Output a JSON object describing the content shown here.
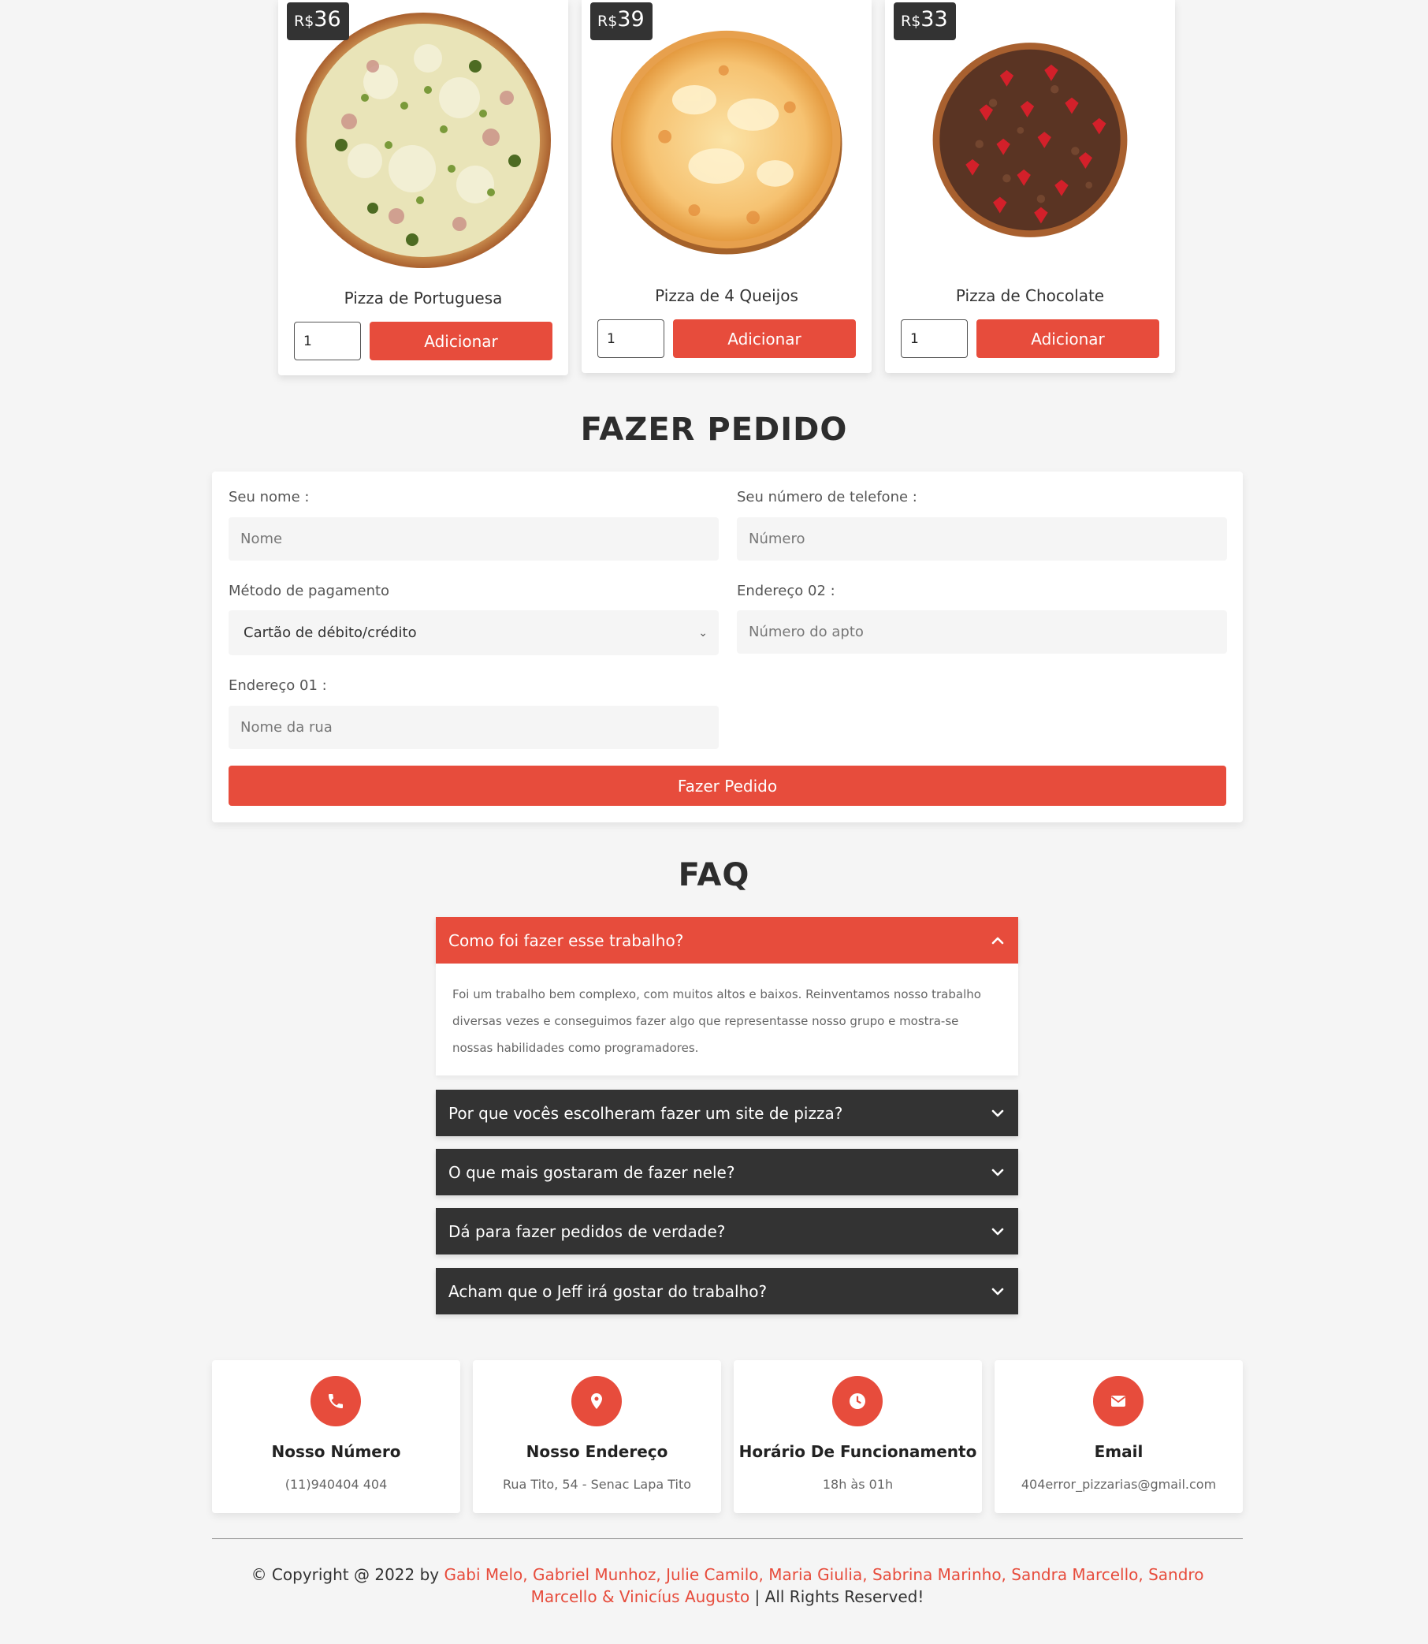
{
  "colors": {
    "accent": "#e74c3c",
    "dark": "#333333",
    "background": "#f5f5f5"
  },
  "pizzas": [
    {
      "currency": "R$",
      "price": "36",
      "name": "Pizza de Portuguesa",
      "qty": "1",
      "button": "Adicionar"
    },
    {
      "currency": "R$",
      "price": "39",
      "name": "Pizza de 4 Queijos",
      "qty": "1",
      "button": "Adicionar"
    },
    {
      "currency": "R$",
      "price": "33",
      "name": "Pizza de Chocolate",
      "qty": "1",
      "button": "Adicionar"
    }
  ],
  "order": {
    "title": "FAZER PEDIDO",
    "name_label": "Seu nome :",
    "name_placeholder": "Nome",
    "phone_label": "Seu número de telefone :",
    "phone_placeholder": "Número",
    "payment_label": "Método de pagamento",
    "payment_value": "Cartão de débito/crédito",
    "address2_label": "Endereço 02 :",
    "address2_placeholder": "Número do apto",
    "address1_label": "Endereço 01 :",
    "address1_placeholder": "Nome da rua",
    "submit": "Fazer Pedido"
  },
  "faq": {
    "title": "FAQ",
    "items": [
      {
        "question": "Como foi fazer esse trabalho?",
        "open": true,
        "answer": "Foi um trabalho bem complexo, com muitos altos e baixos. Reinventamos nosso trabalho diversas vezes e conseguimos fazer algo que representasse nosso grupo e mostra-se nossas habilidades como programadores."
      },
      {
        "question": "Por que vocês escolheram fazer um site de pizza?",
        "open": false
      },
      {
        "question": "O que mais gostaram de fazer nele?",
        "open": false
      },
      {
        "question": "Dá para fazer pedidos de verdade?",
        "open": false
      },
      {
        "question": "Acham que o Jeff irá gostar do trabalho?",
        "open": false
      }
    ]
  },
  "info": [
    {
      "icon": "phone-icon",
      "title": "Nosso Número",
      "text": "(11)940404 404"
    },
    {
      "icon": "location-pin-icon",
      "title": "Nosso Endereço",
      "text": "Rua Tito, 54 - Senac Lapa Tito"
    },
    {
      "icon": "clock-icon",
      "title": "Horário De Funcionamento",
      "text": "18h às 01h"
    },
    {
      "icon": "envelope-icon",
      "title": "Email",
      "text": "404error_pizzarias@gmail.com"
    }
  ],
  "footer": {
    "prefix": "© Copyright @ 2022 by ",
    "authors": "Gabi Melo, Gabriel Munhoz, Julie Camilo, Maria Giulia, Sabrina Marinho, Sandra Marcello, Sandro Marcello & Vinicíus Augusto",
    "suffix": " | All Rights Reserved!"
  }
}
